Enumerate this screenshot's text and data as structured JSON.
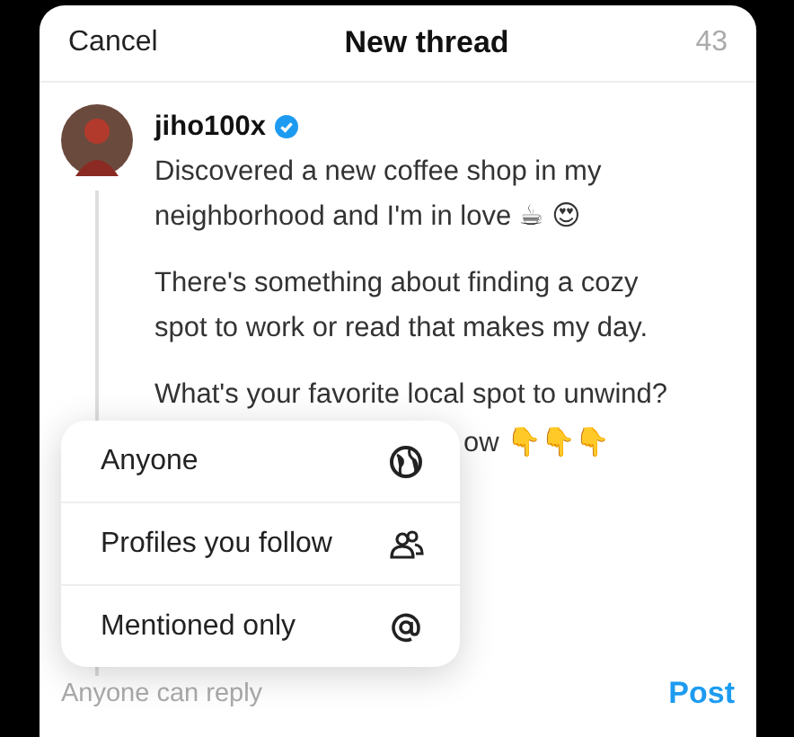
{
  "header": {
    "cancel": "Cancel",
    "title": "New thread",
    "count": "43"
  },
  "post": {
    "username": "jiho100x",
    "verified": true,
    "paragraphs": [
      "Discovered a new coffee shop in my neighborhood and I'm in love ☕ 😍",
      "There's something about finding a cozy spot to work or read that makes my day.",
      "What's your favorite local spot to unwind?"
    ],
    "covered_line": "ow 👇👇👇"
  },
  "reply_menu": [
    {
      "label": "Anyone",
      "kind": "globe"
    },
    {
      "label": "Profiles you follow",
      "kind": "people"
    },
    {
      "label": "Mentioned only",
      "kind": "mention"
    }
  ],
  "footer": {
    "reply_setting": "Anyone can reply",
    "post_button": "Post"
  }
}
